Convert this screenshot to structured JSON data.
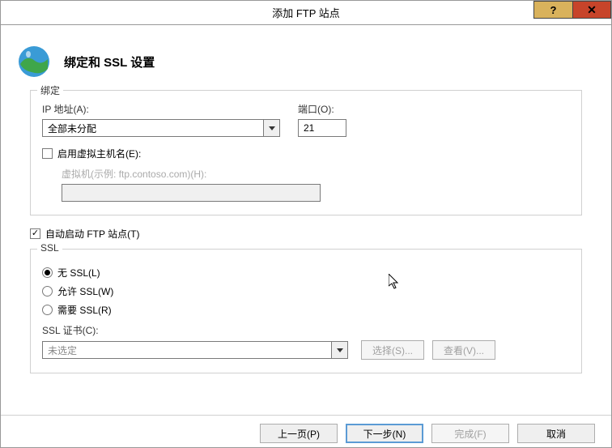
{
  "title": "添加 FTP 站点",
  "header": {
    "title": "绑定和 SSL 设置"
  },
  "binding": {
    "group_label": "绑定",
    "ip_label": "IP 地址(A):",
    "ip_value": "全部未分配",
    "port_label": "端口(O):",
    "port_value": "21",
    "vhost_chk_label": "启用虚拟主机名(E):",
    "vhost_chk_checked": false,
    "vhost_field_label": "虚拟机(示例: ftp.contoso.com)(H):",
    "vhost_value": ""
  },
  "autostart": {
    "label": "自动启动 FTP 站点(T)",
    "checked": true
  },
  "ssl": {
    "group_label": "SSL",
    "options": [
      {
        "label": "无 SSL(L)",
        "selected": true
      },
      {
        "label": "允许 SSL(W)",
        "selected": false
      },
      {
        "label": "需要 SSL(R)",
        "selected": false
      }
    ],
    "cert_label": "SSL 证书(C):",
    "cert_value": "未选定",
    "select_btn": "选择(S)...",
    "view_btn": "查看(V)..."
  },
  "footer": {
    "prev": "上一页(P)",
    "next": "下一步(N)",
    "finish": "完成(F)",
    "cancel": "取消"
  },
  "titlebar": {
    "help": "?",
    "close": "✕"
  }
}
